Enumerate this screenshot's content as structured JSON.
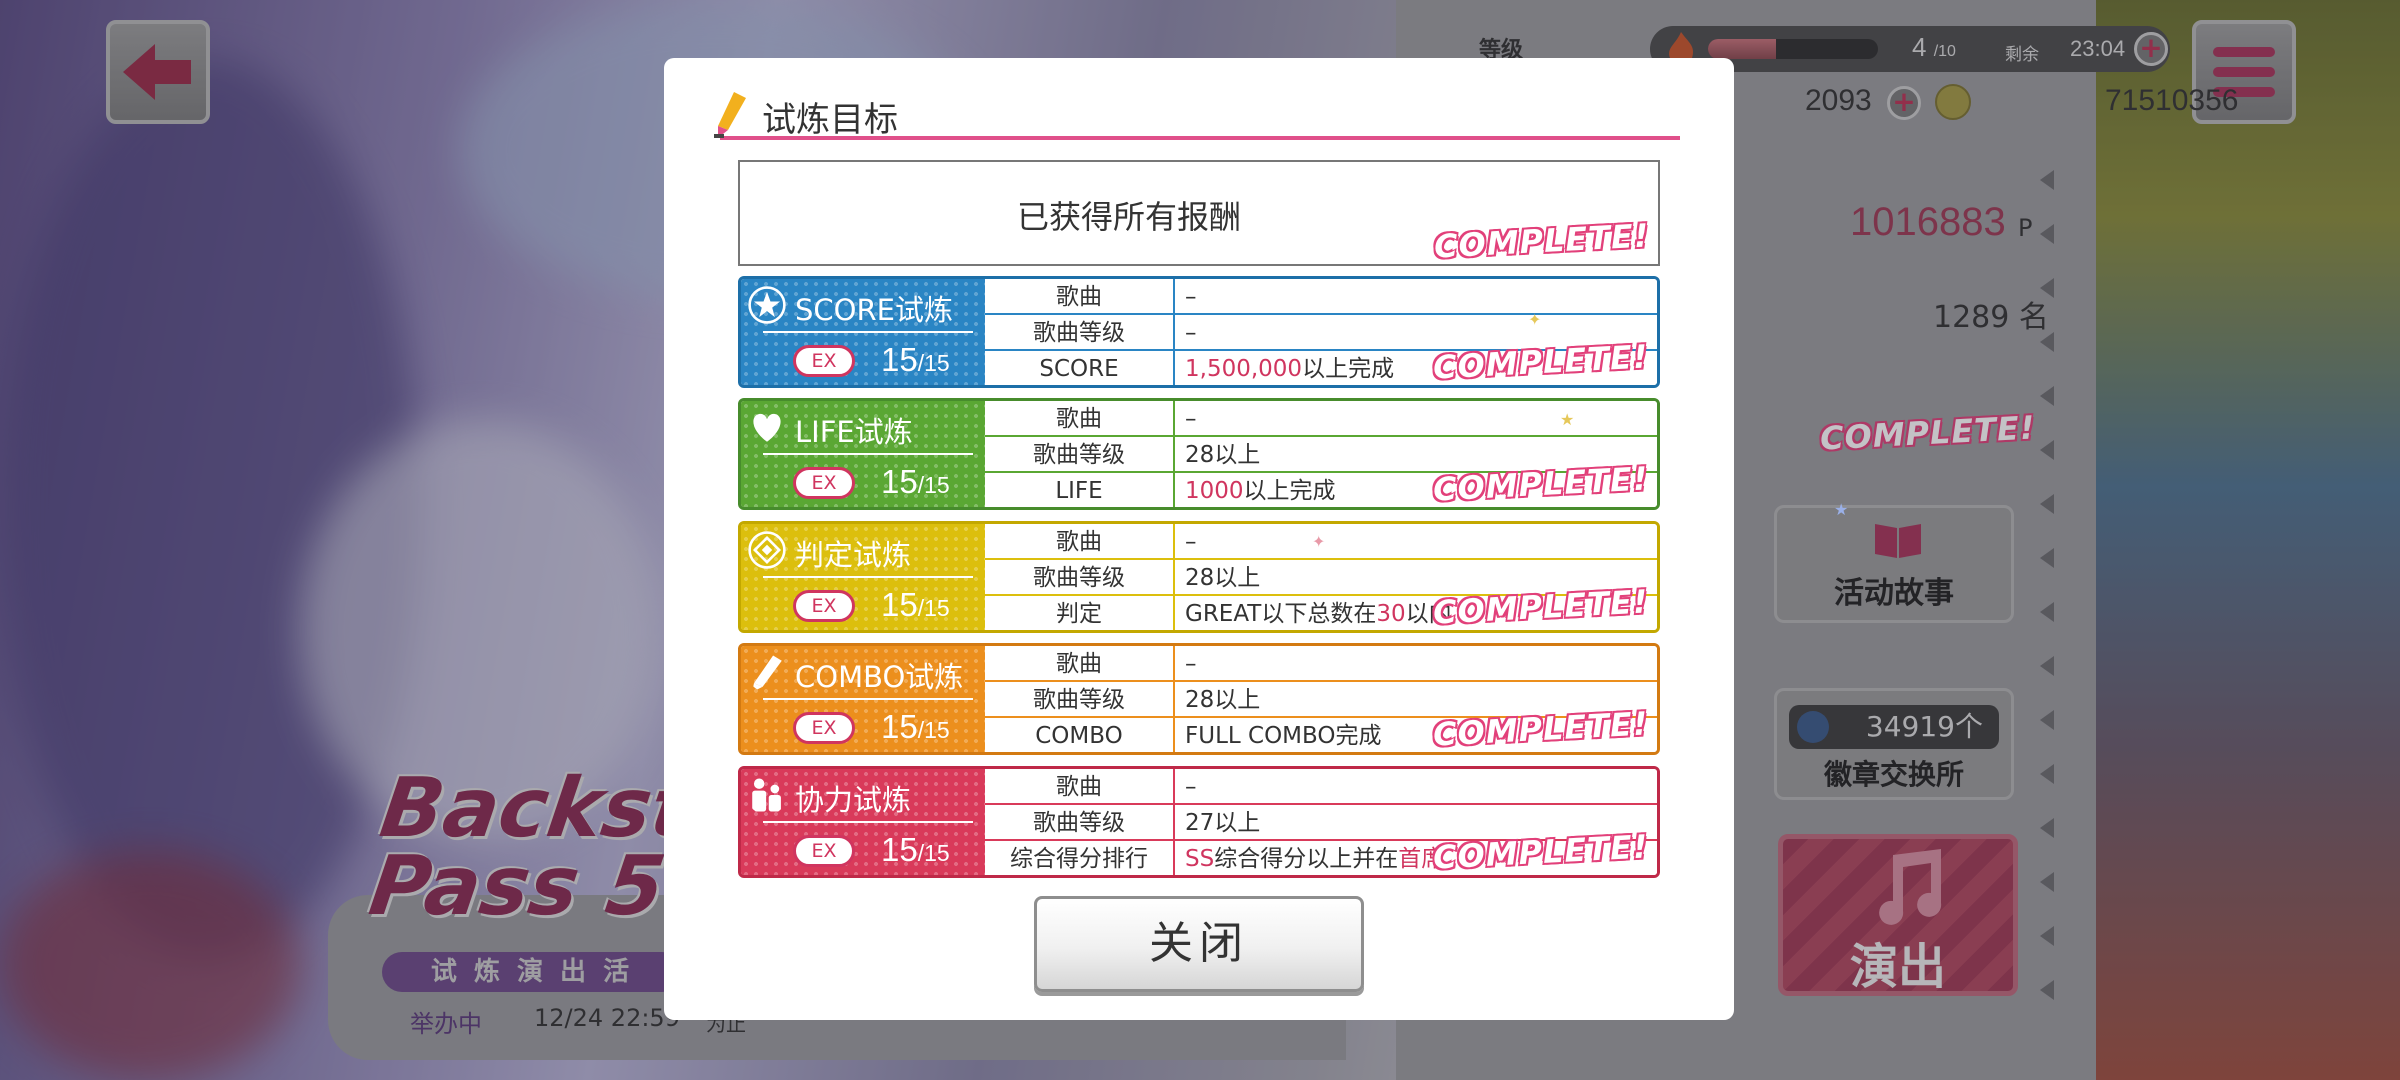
{
  "dialog": {
    "title": "试炼目标",
    "summary": "已获得所有报酬",
    "complete_text": "COMPLETE!",
    "close_label": "关闭"
  },
  "trials": [
    {
      "name": "SCORE试炼",
      "badge": "EX",
      "progress_done": "15",
      "progress_total": "/15",
      "rows": [
        {
          "label": "歌曲",
          "value": "–"
        },
        {
          "label": "歌曲等级",
          "value": "–"
        },
        {
          "label": "SCORE",
          "value_hl": "1,500,000",
          "value_rest": "以上完成"
        }
      ]
    },
    {
      "name": "LIFE试炼",
      "badge": "EX",
      "progress_done": "15",
      "progress_total": "/15",
      "rows": [
        {
          "label": "歌曲",
          "value": "–"
        },
        {
          "label": "歌曲等级",
          "value": "28以上"
        },
        {
          "label": "LIFE",
          "value_hl": "1000",
          "value_rest": "以上完成"
        }
      ]
    },
    {
      "name": "判定试炼",
      "badge": "EX",
      "progress_done": "15",
      "progress_total": "/15",
      "rows": [
        {
          "label": "歌曲",
          "value": "–"
        },
        {
          "label": "歌曲等级",
          "value": "28以上"
        },
        {
          "label": "判定",
          "value_pre": "GREAT以下总数在",
          "value_hl": "30",
          "value_rest": "以内"
        }
      ]
    },
    {
      "name": "COMBO试炼",
      "badge": "EX",
      "progress_done": "15",
      "progress_total": "/15",
      "rows": [
        {
          "label": "歌曲",
          "value": "–"
        },
        {
          "label": "歌曲等级",
          "value": "28以上"
        },
        {
          "label": "COMBO",
          "value": "FULL COMBO完成"
        }
      ]
    },
    {
      "name": "协力试炼",
      "badge": "EX",
      "progress_done": "15",
      "progress_total": "/15",
      "rows": [
        {
          "label": "歌曲",
          "value": "–"
        },
        {
          "label": "歌曲等级",
          "value": "27以上"
        },
        {
          "label": "综合得分排行",
          "value_hl": "SS",
          "value_mid": "综合得分以上并在",
          "value_hl2": "首席"
        }
      ]
    }
  ],
  "status_bar": {
    "level_label": "等级",
    "stamina_current": "4",
    "stamina_max": "/10",
    "stamina_fraction": 0.4,
    "remain_label": "剩余",
    "remain_time": "23:04",
    "stars": "2093",
    "coins": "71510356"
  },
  "event_panel": {
    "points": "1016883",
    "points_unit": "P",
    "rank": "1289 名",
    "story_button": "活动故事",
    "badge_count": "34919个",
    "badge_exchange": "徽章交换所",
    "play_button": "演出"
  },
  "event_banner": {
    "logo": "Backsta\nPass 5",
    "mode": "试 炼 演 出 活",
    "state": "举办中",
    "date": "12/24 22:59",
    "tail": "为止"
  },
  "colors": {
    "accent": "#e0508a",
    "score": "#2a85c4",
    "life": "#5aa733",
    "judge": "#dcbf0d",
    "combo": "#ec8f1d",
    "coop": "#d93a5a"
  }
}
